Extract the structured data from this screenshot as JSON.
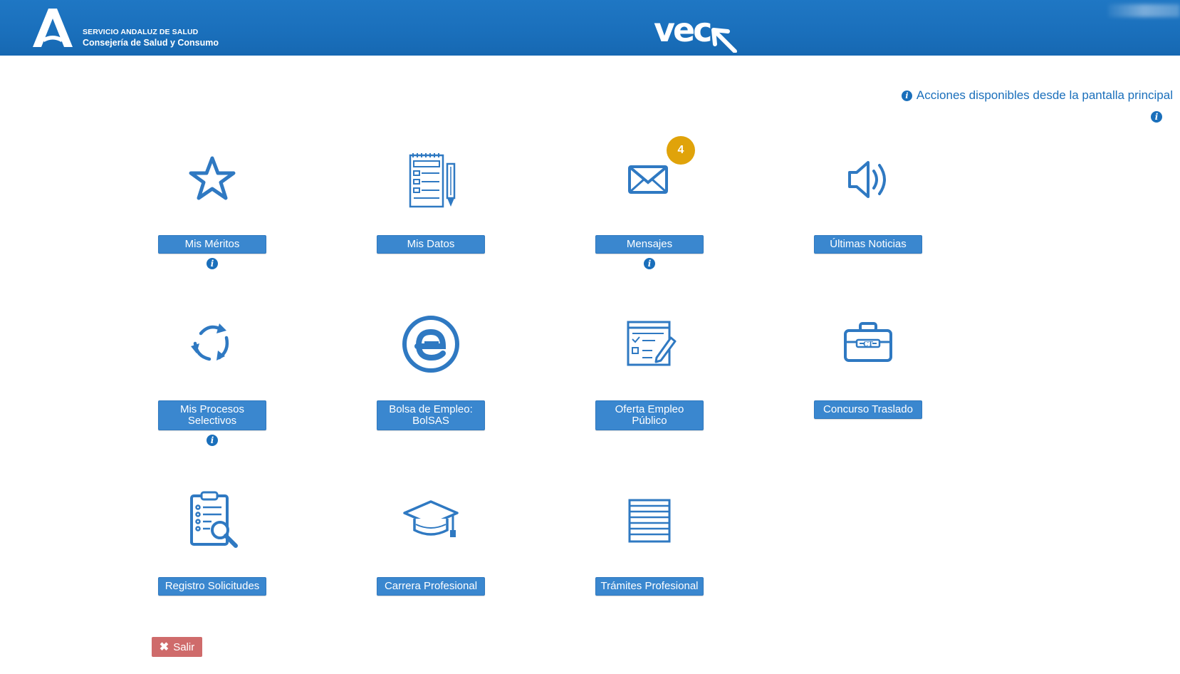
{
  "header": {
    "org_line1": "SERVICIO ANDALUZ DE SALUD",
    "org_line2": "Consejería de Salud y Consumo",
    "app_logo": "vec",
    "logo_icon": "junta-andalucia-logo",
    "brand_color": "#1a6fbb"
  },
  "help": {
    "text": "Acciones disponibles desde la pantalla principal"
  },
  "tiles": [
    {
      "label": "Mis Méritos",
      "icon": "star-icon"
    },
    {
      "label": "Mis Datos",
      "icon": "notebook-icon"
    },
    {
      "label": "Mensajes",
      "icon": "envelope-icon",
      "badge": "4"
    },
    {
      "label": "Últimas Noticias",
      "icon": "speaker-icon"
    },
    {
      "label": "Mis Procesos Selectivos",
      "icon": "refresh-icon"
    },
    {
      "label": "Bolsa de Empleo: BolSAS",
      "icon": "e-letter-icon"
    },
    {
      "label": "Oferta Empleo Público",
      "icon": "checklist-form-icon"
    },
    {
      "label": "Concurso Traslado",
      "icon": "briefcase-icon"
    },
    {
      "label": "Registro Solicitudes",
      "icon": "clipboard-search-icon"
    },
    {
      "label": "Carrera Profesional",
      "icon": "graduation-cap-icon"
    },
    {
      "label": "Trámites Profesional",
      "icon": "document-lines-icon"
    }
  ],
  "exit": {
    "label": "Salir",
    "color": "#cf6b6b"
  },
  "colors": {
    "button": "#3a87cf",
    "badge": "#e0a30a"
  }
}
